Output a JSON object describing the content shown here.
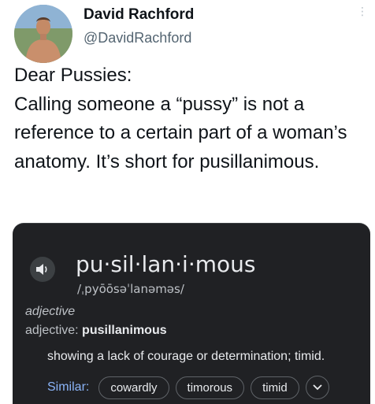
{
  "tweet": {
    "display_name": "David Rachford",
    "handle": "@DavidRachford",
    "text_lines": [
      "Dear Pussies:",
      "Calling someone a “pussy” is not a reference to a certain part of a woman’s anatomy.  It’s short for pusillanimous."
    ]
  },
  "dictionary": {
    "word": "pu·sil·lan·i·mous",
    "phonetic": "/ˌpyōōsəˈlanəməs/",
    "part_of_speech": "adjective",
    "pos_prefix": "adjective: ",
    "pos_word": "pusillanimous",
    "definition": "showing a lack of courage or determination; timid.",
    "similar_label": "Similar:",
    "similar": [
      "cowardly",
      "timorous",
      "timid"
    ]
  },
  "icons": {
    "speaker": "speaker-icon",
    "expand": "chevron-down-icon",
    "menu": "more-dots-icon"
  },
  "colors": {
    "card_bg": "#202124",
    "similar_label": "#8ab4f8",
    "handle": "#536471"
  }
}
